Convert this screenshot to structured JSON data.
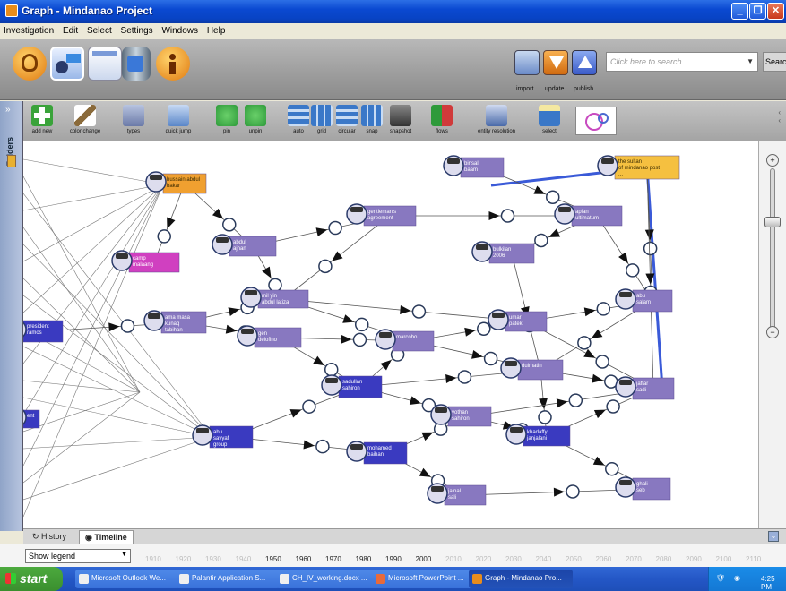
{
  "window": {
    "title": "Graph - Mindanao Project"
  },
  "menu": [
    "Investigation",
    "Edit",
    "Select",
    "Settings",
    "Windows",
    "Help"
  ],
  "top_toolbar": {
    "buttons": [
      {
        "label": "import",
        "icon": "import-icon"
      },
      {
        "label": "update",
        "icon": "update-icon"
      },
      {
        "label": "publish",
        "icon": "publish-icon"
      }
    ],
    "search": {
      "placeholder": "Click here to search",
      "button": "Searc"
    }
  },
  "graph_toolbar": [
    {
      "label": "add new",
      "icon": "add-icon",
      "color": "#3AA33A"
    },
    {
      "label": "color change",
      "icon": "brush-icon",
      "color": "#8A6A3A"
    },
    {
      "label": "types",
      "icon": "types-icon",
      "color": "#6B7AA8"
    },
    {
      "label": "quick jump",
      "icon": "quick-jump-icon",
      "color": "#5A86C8"
    },
    {
      "label": "pin",
      "icon": "pin-icon",
      "color": "#2E9A3A"
    },
    {
      "label": "unpin",
      "icon": "unpin-icon",
      "color": "#2E9A3A"
    },
    {
      "label": "auto",
      "icon": "auto-layout-icon",
      "color": "#3A78C8"
    },
    {
      "label": "grid",
      "icon": "grid-layout-icon",
      "color": "#3A78C8"
    },
    {
      "label": "circular",
      "icon": "circular-layout-icon",
      "color": "#3A78C8"
    },
    {
      "label": "snap",
      "icon": "snap-icon",
      "color": "#3A78C8"
    },
    {
      "label": "snapshot",
      "icon": "camera-icon",
      "color": "#444"
    },
    {
      "label": "flows",
      "icon": "flows-icon",
      "color": "#2E9A3A"
    },
    {
      "label": "entity resolution",
      "icon": "entity-resolution-icon",
      "color": "#4A6AA8"
    },
    {
      "label": "select",
      "icon": "select-icon",
      "color": "#3A78C8"
    }
  ],
  "left_panel": {
    "label": "Folders"
  },
  "graph": {
    "nodes": [
      {
        "id": "n1",
        "label": "hussain abdul\nbakar",
        "color": "#F0A030",
        "textcolor": "#3A2A00"
      },
      {
        "id": "n2",
        "label": "binsali\nbaam",
        "color": "#8878C0",
        "textcolor": "#fff"
      },
      {
        "id": "n3",
        "label": "the sultan\nof mindanao post\n...",
        "color": "#F5C040",
        "textcolor": "#3A2A00"
      },
      {
        "id": "n4",
        "label": "gentleman's\nagreement",
        "color": "#8878C0",
        "textcolor": "#fff"
      },
      {
        "id": "n5",
        "label": "aplan\nultimatum",
        "color": "#8878C0",
        "textcolor": "#fff"
      },
      {
        "id": "n6",
        "label": "abdul\najhan",
        "color": "#8878C0",
        "textcolor": "#fff"
      },
      {
        "id": "n7",
        "label": "camp\nmalaang",
        "color": "#D040C0",
        "textcolor": "#fff"
      },
      {
        "id": "n8",
        "label": "bulkilan\n2006",
        "color": "#8878C0",
        "textcolor": "#fff"
      },
      {
        "id": "n9",
        "label": "abu\nsalam",
        "color": "#8878C0",
        "textcolor": "#fff"
      },
      {
        "id": "n10",
        "label": "president\nramos",
        "color": "#3A3AC0",
        "textcolor": "#fff"
      },
      {
        "id": "n11",
        "label": "ama masa\nkunaq\ntabihan",
        "color": "#8878C0",
        "textcolor": "#fff"
      },
      {
        "id": "n12",
        "label": "mil yin\nabdul latiza",
        "color": "#8878C0",
        "textcolor": "#fff"
      },
      {
        "id": "n13",
        "label": "gen\ndelofino",
        "color": "#8878C0",
        "textcolor": "#fff"
      },
      {
        "id": "n14",
        "label": "marcobo",
        "color": "#8878C0",
        "textcolor": "#fff"
      },
      {
        "id": "n15",
        "label": "umar\npatek",
        "color": "#8878C0",
        "textcolor": "#fff"
      },
      {
        "id": "n16",
        "label": "dulmatin",
        "color": "#8878C0",
        "textcolor": "#fff"
      },
      {
        "id": "n17",
        "label": "sadullan\nsahiron",
        "color": "#3A3AC0",
        "textcolor": "#fff"
      },
      {
        "id": "n18",
        "label": "yothan\nsahiron",
        "color": "#8878C0",
        "textcolor": "#fff"
      },
      {
        "id": "n19",
        "label": "jaffar\nsadi",
        "color": "#8878C0",
        "textcolor": "#fff"
      },
      {
        "id": "n20",
        "label": "khadaffy\njanjalani",
        "color": "#3A3AC0",
        "textcolor": "#fff"
      },
      {
        "id": "n21",
        "label": "abu\nsayyaf\ngroup",
        "color": "#3A3AC0",
        "textcolor": "#fff"
      },
      {
        "id": "n22",
        "label": "mohamed\nbaihani",
        "color": "#3A3AC0",
        "textcolor": "#fff"
      },
      {
        "id": "n23",
        "label": "jainal\nsali",
        "color": "#8878C0",
        "textcolor": "#fff"
      },
      {
        "id": "n24",
        "label": "ghali\nseb",
        "color": "#8878C0",
        "textcolor": "#fff"
      },
      {
        "id": "n25",
        "label": "ent",
        "color": "#3A3AC0",
        "textcolor": "#fff"
      }
    ]
  },
  "bottom_tabs": [
    "History",
    "Timeline"
  ],
  "timeline": {
    "legend_select": "Show legend",
    "years": [
      "1910",
      "1920",
      "1930",
      "1940",
      "1950",
      "1960",
      "1970",
      "1980",
      "1990",
      "2000",
      "2010",
      "2020",
      "2030",
      "2040",
      "2050",
      "2060",
      "2070",
      "2080",
      "2090",
      "2100",
      "2110"
    ]
  },
  "taskbar": {
    "start": "start",
    "tasks": [
      "Microsoft Outlook We...",
      "Palantir Application S...",
      "CH_IV_working.docx ...",
      "Microsoft PowerPoint ...",
      "Graph - Mindanao Pro..."
    ],
    "clock": "4:25 PM"
  }
}
